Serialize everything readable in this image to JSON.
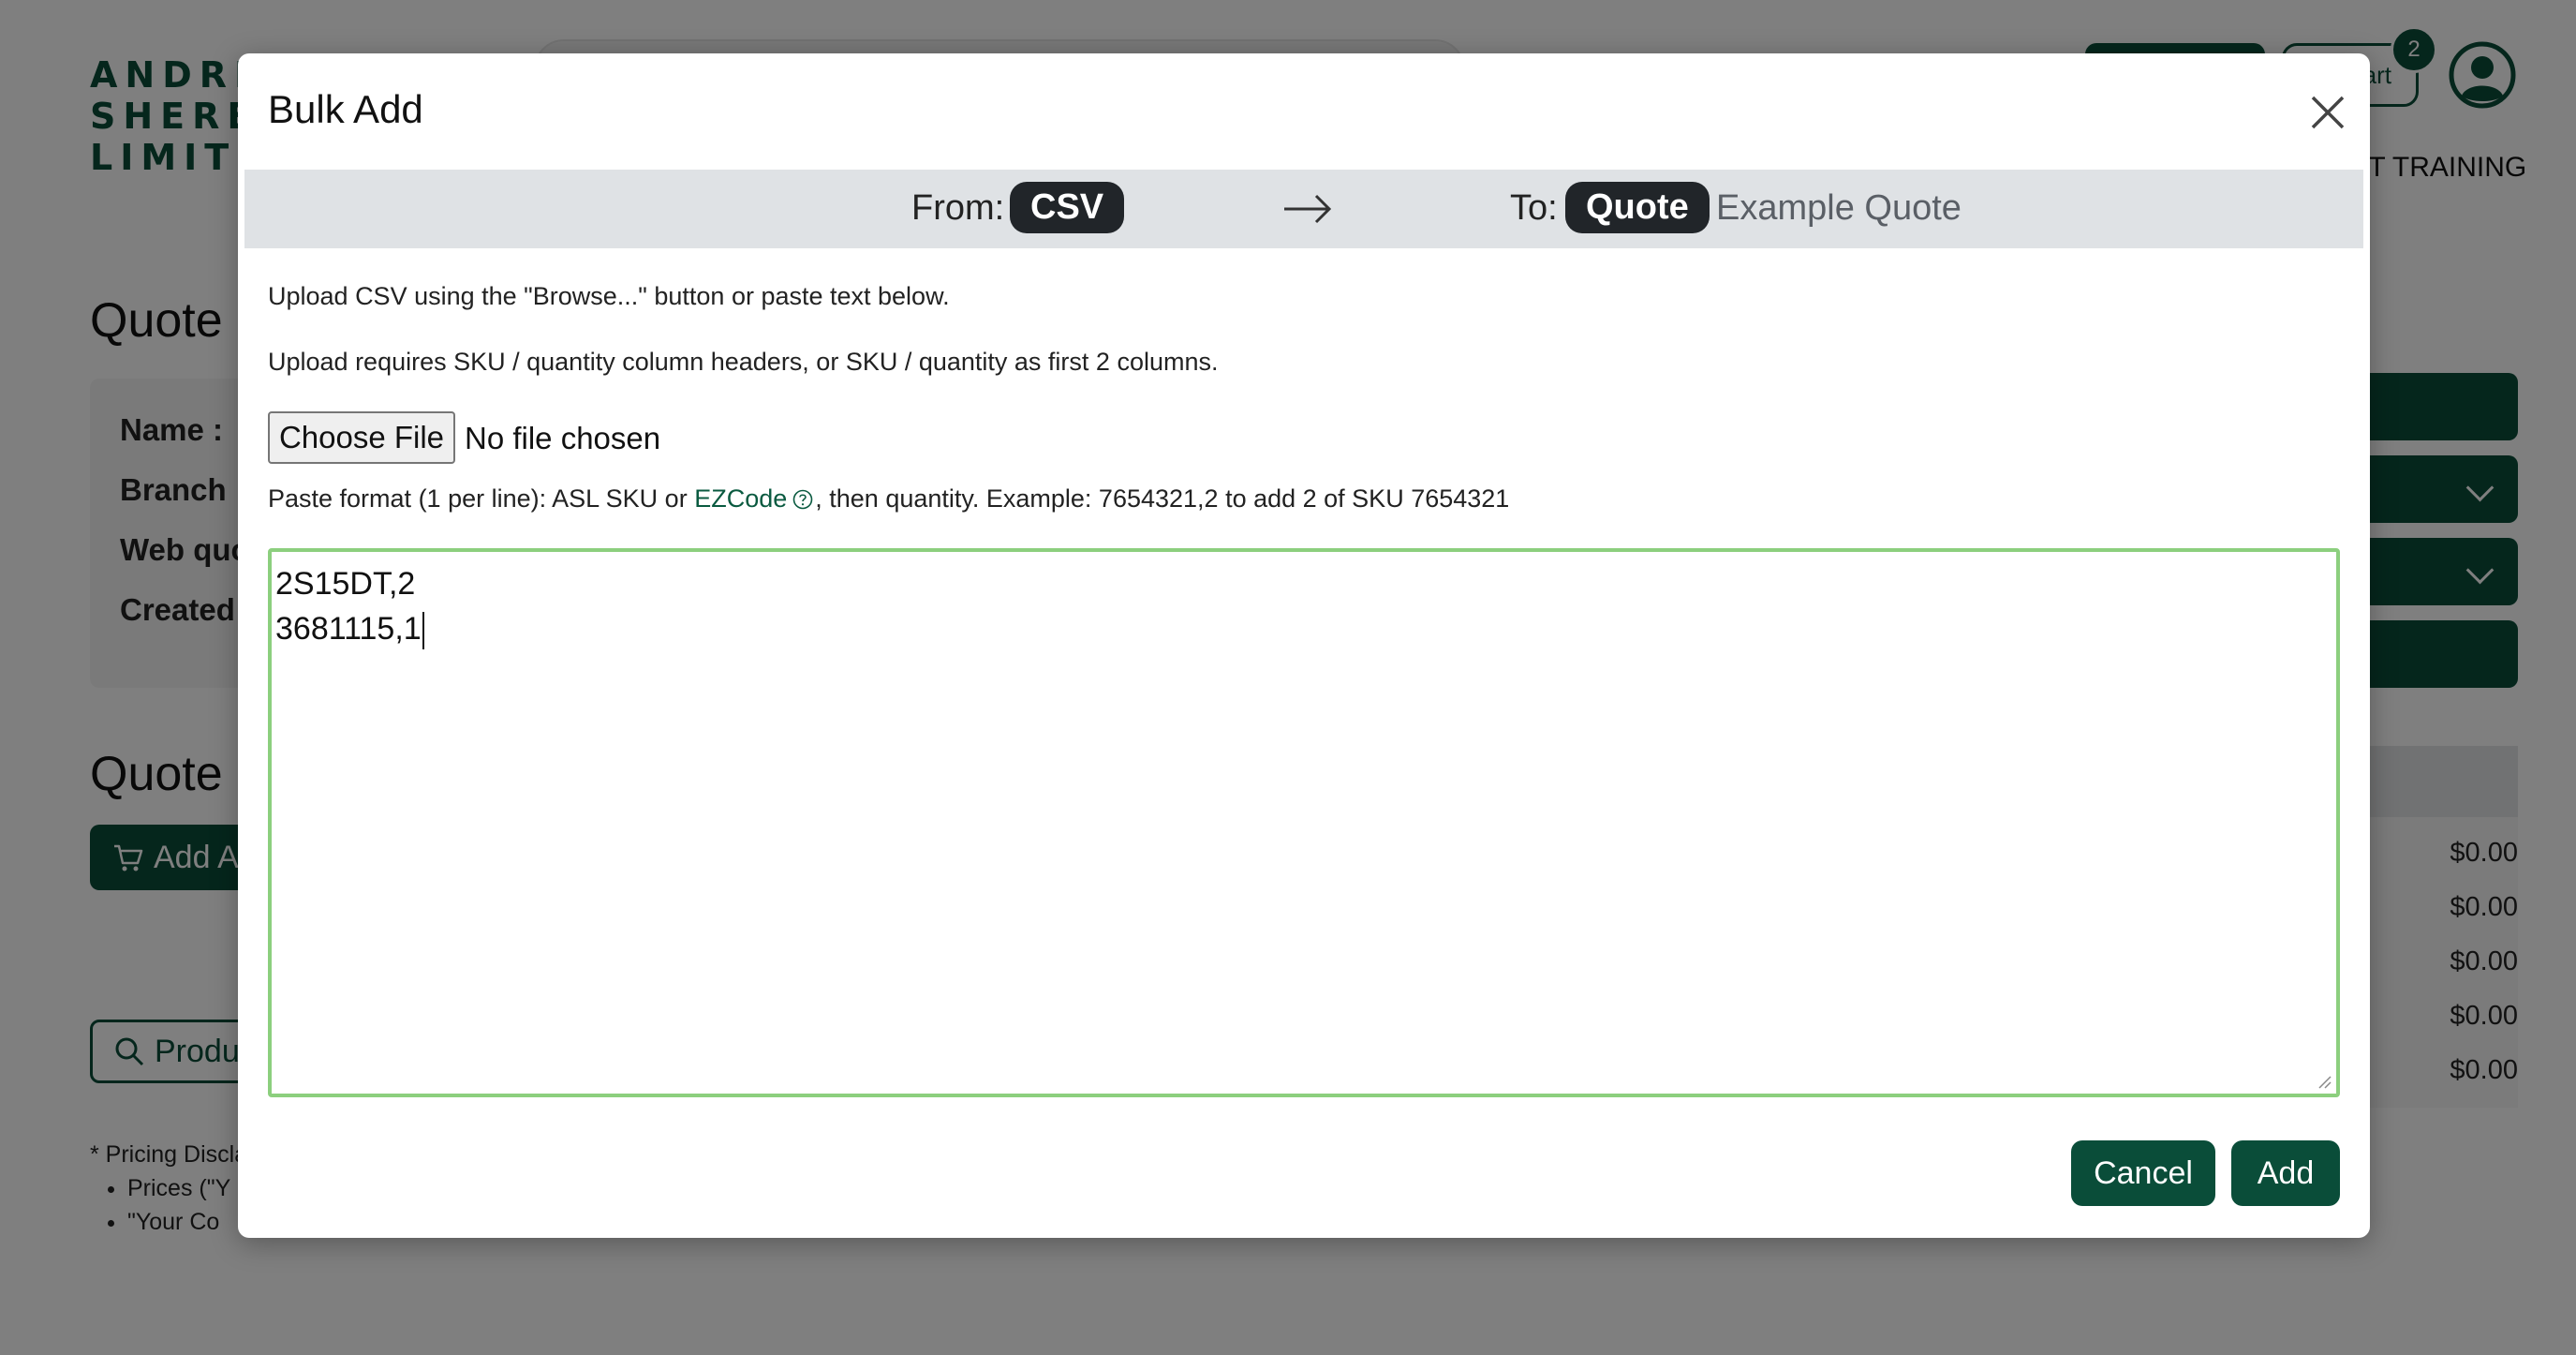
{
  "background": {
    "logo_lines": [
      "ANDRE",
      "SHERE",
      "LIMITE"
    ],
    "cart_label": "art",
    "cart_count": "2",
    "nav_text": "IT TRAINING",
    "section1_title": "Quote I",
    "fields": [
      "Name :",
      "Branch :",
      "Web quo",
      "Created"
    ],
    "section2_title": "Quote I",
    "add_button": "Add A",
    "product_button": "Produ",
    "disclaimer_title": "* Pricing Discla",
    "disclaimer_items": [
      "Prices (\"Y",
      "\"Your Co"
    ],
    "prices": [
      "$0.00",
      "$0.00",
      "$0.00",
      "$0.00",
      "$0.00"
    ]
  },
  "modal": {
    "title": "Bulk Add",
    "from_label": "From:",
    "from_value": "CSV",
    "to_label": "To:",
    "to_value": "Quote",
    "to_name": "Example Quote",
    "info1": "Upload CSV using the \"Browse...\" button or paste text below.",
    "info2": "Upload requires SKU / quantity column headers, or SKU / quantity as first 2 columns.",
    "file_button": "Choose File",
    "file_status": "No file chosen",
    "paste_before": "Paste format (1 per line): ASL SKU or ",
    "paste_link": "EZCode",
    "paste_after": ", then quantity. Example: 7654321,2 to add 2 of SKU 7654321",
    "textarea_lines": [
      "2S15DT,2",
      "3681115,1"
    ],
    "cancel_label": "Cancel",
    "add_label": "Add"
  },
  "colors": {
    "brand": "#0a4d39",
    "overlay": "rgba(0,0,0,0.5)",
    "focus_border": "#8ccf7e",
    "pill": "#212529"
  }
}
